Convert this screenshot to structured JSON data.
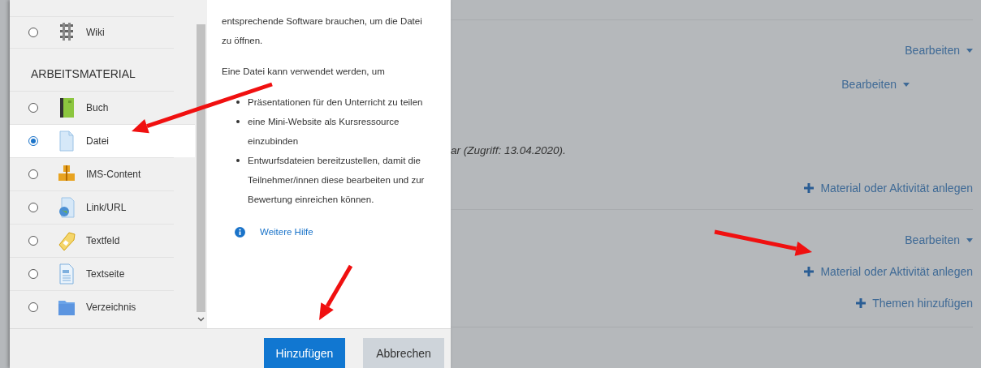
{
  "dialog": {
    "activities": [
      {
        "label": "Wiki",
        "kind": "wiki",
        "selected": false
      }
    ],
    "resources": {
      "heading": "ARBEITSMATERIAL",
      "items": [
        {
          "label": "Buch",
          "kind": "book",
          "selected": false
        },
        {
          "label": "Datei",
          "kind": "file",
          "selected": true
        },
        {
          "label": "IMS-Content",
          "kind": "package",
          "selected": false
        },
        {
          "label": "Link/URL",
          "kind": "url",
          "selected": false
        },
        {
          "label": "Textfeld",
          "kind": "label",
          "selected": false
        },
        {
          "label": "Textseite",
          "kind": "page",
          "selected": false
        },
        {
          "label": "Verzeichnis",
          "kind": "folder",
          "selected": false
        }
      ]
    },
    "description": {
      "paragraphs": [
        "entsprechende Software brauchen, um die Datei zu öffnen.",
        "Eine Datei kann verwendet werden, um"
      ],
      "bullets": [
        "Präsentationen für den Unterricht zu teilen",
        "eine Mini-Website als Kursressource einzubinden",
        "Entwurfsdateien bereitzustellen, damit die Teilnehmer/innen diese bearbeiten und zur Bewertung einreichen können."
      ],
      "help_link": "Weitere Hilfe"
    },
    "buttons": [
      {
        "label": "Hinzufügen",
        "kind": "primary"
      },
      {
        "label": "Abbrechen",
        "kind": "secondary"
      }
    ]
  },
  "course": {
    "sections": [
      {
        "rows": [
          {
            "kind": "section-menu",
            "label": "Bearbeiten"
          },
          {
            "kind": "activity-menu",
            "label": "Bearbeiten"
          },
          {
            "kind": "note",
            "label": "ar (Zugriff: 13.04.2020)."
          },
          {
            "kind": "add",
            "label": "Material oder Aktivität anlegen"
          }
        ]
      },
      {
        "rows": [
          {
            "kind": "section-menu",
            "label": "Bearbeiten"
          },
          {
            "kind": "add",
            "label": "Material oder Aktivität anlegen"
          },
          {
            "kind": "add",
            "label": "Themen hinzufügen"
          }
        ]
      }
    ]
  }
}
